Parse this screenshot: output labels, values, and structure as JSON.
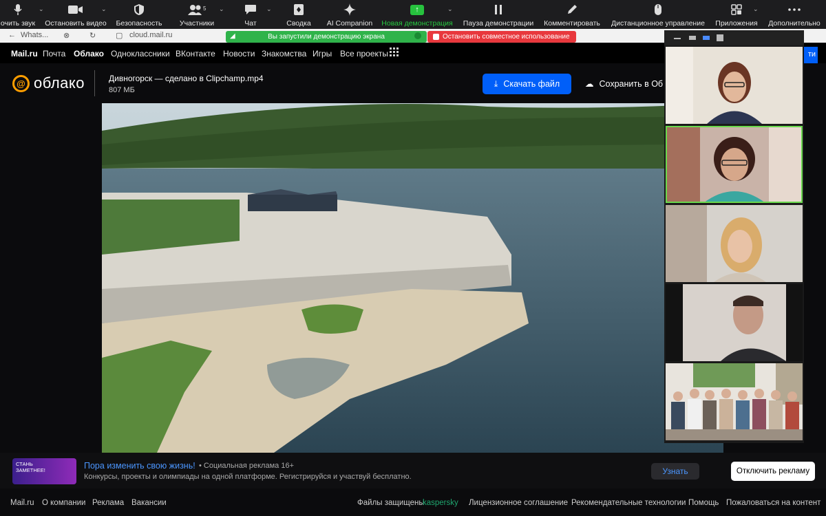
{
  "toolbar": {
    "items": [
      {
        "label": "очить звук",
        "icon": "microphone-icon"
      },
      {
        "label": "Остановить видео",
        "icon": "video-camera-icon"
      },
      {
        "label": "Безопасность",
        "icon": "shield-icon"
      },
      {
        "label": "Участники",
        "icon": "participants-icon",
        "count": "5"
      },
      {
        "label": "Чат",
        "icon": "chat-icon"
      },
      {
        "label": "Сводка",
        "icon": "summary-icon"
      },
      {
        "label": "AI Companion",
        "icon": "sparkle-icon"
      },
      {
        "label": "Новая демонстрация",
        "icon": "share-screen-icon"
      },
      {
        "label": "Пауза демонстрации",
        "icon": "pause-icon"
      },
      {
        "label": "Комментировать",
        "icon": "pencil-icon"
      },
      {
        "label": "Дистанционное управление",
        "icon": "mouse-icon"
      },
      {
        "label": "Приложения",
        "icon": "apps-icon"
      },
      {
        "label": "Дополнительно",
        "icon": "more-icon"
      }
    ]
  },
  "browser": {
    "tab": "Whats...",
    "url": "cloud.mail.ru"
  },
  "sharing": {
    "banner": "Вы запустили демонстрацию экрана",
    "stop": "Остановить совместное использование"
  },
  "mailnav": {
    "items": [
      "Mail.ru",
      "Почта",
      "Облако",
      "Одноклассники",
      "ВКонтакте",
      "Новости",
      "Знакомства",
      "Игры",
      "Все проекты"
    ]
  },
  "cloud": {
    "logo": "облако",
    "file_name": "Дивногорск — сделано в Clipchamp.mp4",
    "file_size": "807 МБ",
    "download": "Скачать файл",
    "save": "Сохранить в Об",
    "right_btn": "ти"
  },
  "ad": {
    "image_text_1": "СТАНЬ",
    "image_text_2": "ЗАМЕТНЕЕ!",
    "title": "Пора изменить свою жизнь!",
    "sub": "• Социальная реклама 16+",
    "desc": "Конкурсы, проекты и олимпиады на одной платформе. Регистрируйся и участвуй бесплатно.",
    "button": "Узнать",
    "disable": "Отключить рекламу"
  },
  "footer": {
    "left": [
      "Mail.ru",
      "О компании",
      "Реклама",
      "Вакансии"
    ],
    "protected": "Файлы защищены",
    "kaspersky": "kaspersky",
    "right": [
      "Лицензионное соглашение",
      "Рекомендательные технологии",
      "Помощь",
      "Пожаловаться на контент"
    ]
  },
  "colors": {
    "accent_blue": "#005ff9",
    "zoom_green": "#28c840",
    "stop_red": "#e8383d",
    "logo_orange": "#ff9e00"
  }
}
